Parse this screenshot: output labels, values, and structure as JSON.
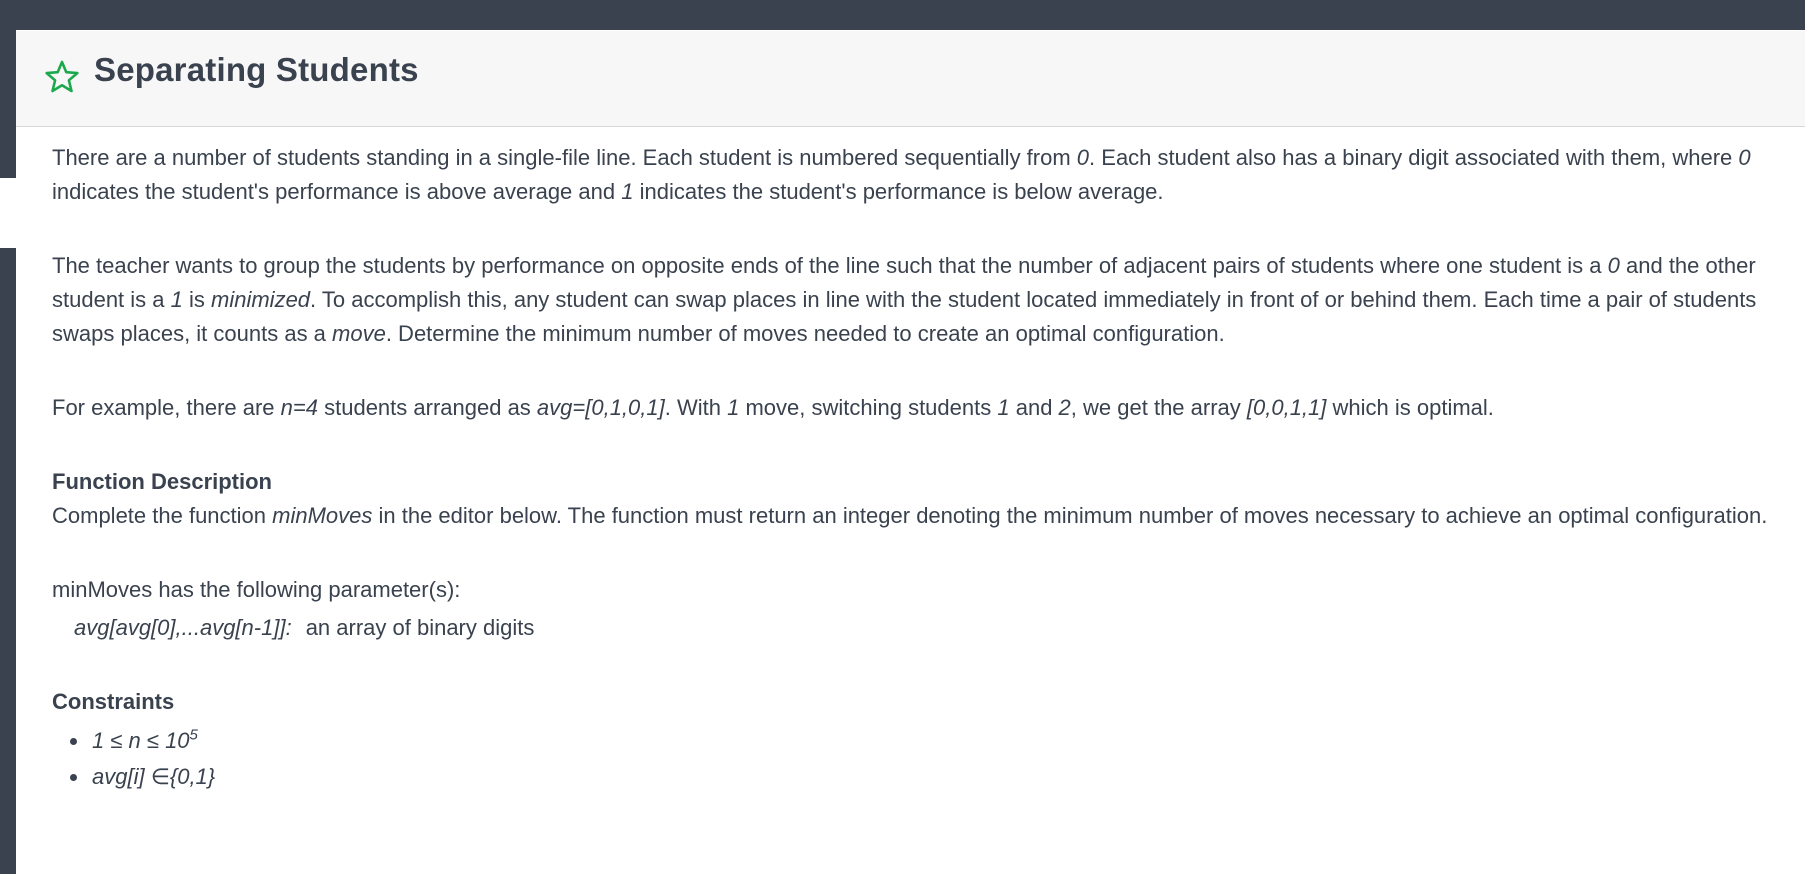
{
  "problem": {
    "title": "Separating Students",
    "star_icon_color": "#1ba94c"
  },
  "paragraph1": {
    "part1": "There are a number of students standing in a single-file line. Each student is numbered sequentially from ",
    "zero1": "0",
    "part2": ". Each student also has a binary digit associated with them, where ",
    "zero2": "0",
    "part3": " indicates the student's performance is above average and ",
    "one1": "1",
    "part4": " indicates the student's performance is below average."
  },
  "paragraph2": {
    "part1": "The teacher wants to group the students by performance on opposite ends of the line such that the number of adjacent pairs of students where one student is a ",
    "zero": "0",
    "part2": " and the other student is a ",
    "one": "1",
    "part3": " is ",
    "minimized": "minimized",
    "part4": ". To accomplish this, any student can swap places in line with the student located immediately in front of or behind them. Each time a pair of students swaps places, it counts as a ",
    "move": "move",
    "part5": ". Determine the minimum number of moves needed to create an optimal configuration."
  },
  "paragraph3": {
    "part1": "For example, there are ",
    "n_eq": "n=4",
    "part2": " students arranged as ",
    "avg_eq": "avg=[0,1,0,1]",
    "part3": ". With ",
    "one": "1",
    "part4": " move, switching students ",
    "s1": "1",
    "part5": " and ",
    "s2": "2",
    "part6": ", we get the array ",
    "result": "[0,0,1,1]",
    "part7": " which is optimal."
  },
  "function_description": {
    "heading": "Function Description",
    "part1": "Complete the function ",
    "fn_name": "minMoves",
    "part2": " in the editor below. The function must return an integer denoting the minimum number of moves necessary to achieve an optimal configuration."
  },
  "parameters": {
    "title": "minMoves has the following parameter(s):",
    "name": "avg[avg[0],...avg[n-1]]:",
    "desc": "an array of binary digits"
  },
  "constraints": {
    "heading": "Constraints",
    "c1_main": "1 ≤ n ≤ 10",
    "c1_sup": "5",
    "c2": "avg[i] ∈{0,1}"
  }
}
